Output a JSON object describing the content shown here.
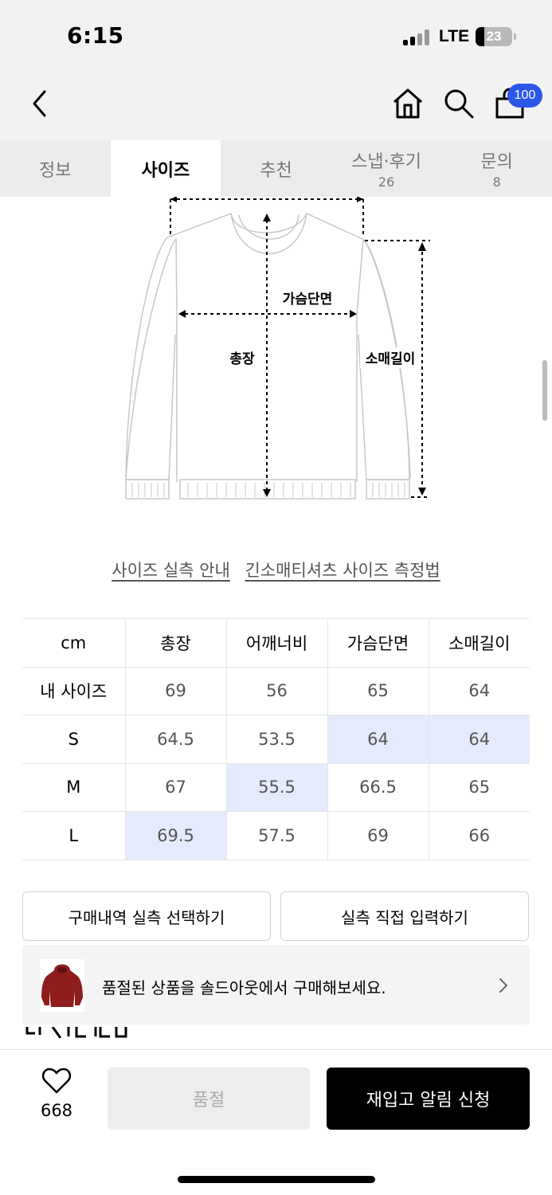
{
  "status_bar": {
    "time": "6:15",
    "network": "LTE",
    "battery": "23"
  },
  "nav": {
    "cart_badge": "100",
    "icons": [
      "back-icon",
      "home-icon",
      "search-icon",
      "cart-icon"
    ]
  },
  "tabs": [
    {
      "label": "정보",
      "count": ""
    },
    {
      "label": "사이즈",
      "count": ""
    },
    {
      "label": "추천",
      "count": ""
    },
    {
      "label": "스냅·후기",
      "count": "26"
    },
    {
      "label": "문의",
      "count": "8"
    }
  ],
  "active_tab": 1,
  "diagram": {
    "chest": "가슴단면",
    "length": "총장",
    "sleeve": "소매길이"
  },
  "links": {
    "guide": "사이즈 실측 안내",
    "method": "긴소매티셔츠 사이즈 측정법"
  },
  "size_table": {
    "headers": [
      "cm",
      "총장",
      "어깨너비",
      "가슴단면",
      "소매길이"
    ],
    "rows": [
      {
        "label": "내 사이즈",
        "values": [
          "69",
          "56",
          "65",
          "64"
        ]
      },
      {
        "label": "S",
        "values": [
          "64.5",
          "53.5",
          "64",
          "64"
        ]
      },
      {
        "label": "M",
        "values": [
          "67",
          "55.5",
          "66.5",
          "65"
        ]
      },
      {
        "label": "L",
        "values": [
          "69.5",
          "57.5",
          "69",
          "66"
        ]
      }
    ],
    "highlight_color": "#e5ebfc"
  },
  "buttons": {
    "purchase_history": "구매내역 실측 선택하기",
    "manual_input": "실측 직접 입력하기"
  },
  "banner": {
    "text": "품절된 상품을 솔드아웃에서 구매해보세요."
  },
  "bottom": {
    "like_count": "668",
    "soldout_label": "품절",
    "notify_label": "재입고 알림 신청"
  },
  "colors": {
    "accent": "#2b57e8",
    "primary_button": "#000000",
    "disabled_button": "#ededed"
  }
}
